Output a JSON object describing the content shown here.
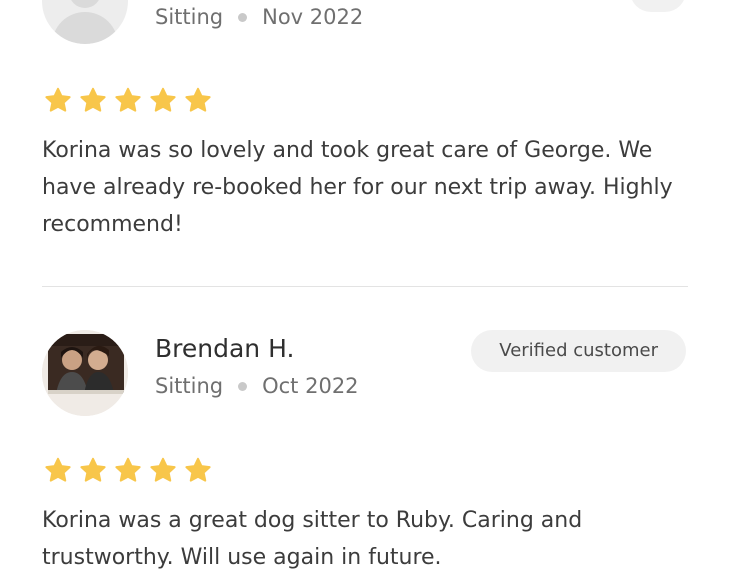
{
  "reviews": [
    {
      "name": "",
      "service": "Sitting",
      "date": "Nov 2022",
      "badge": "",
      "rating": 5,
      "star_color": "#f8c64a",
      "avatar": "generic-avatar",
      "text": "Korina was so lovely and took great care of George. We have already re-booked her for our next trip away. Highly recommend!"
    },
    {
      "name": "Brendan H.",
      "service": "Sitting",
      "date": "Oct 2022",
      "badge": "Verified customer",
      "rating": 5,
      "star_color": "#f8c64a",
      "avatar": "photo-avatar",
      "text": "Korina was a great dog sitter to Ruby. Caring and trustworthy. Will use again in future."
    }
  ]
}
